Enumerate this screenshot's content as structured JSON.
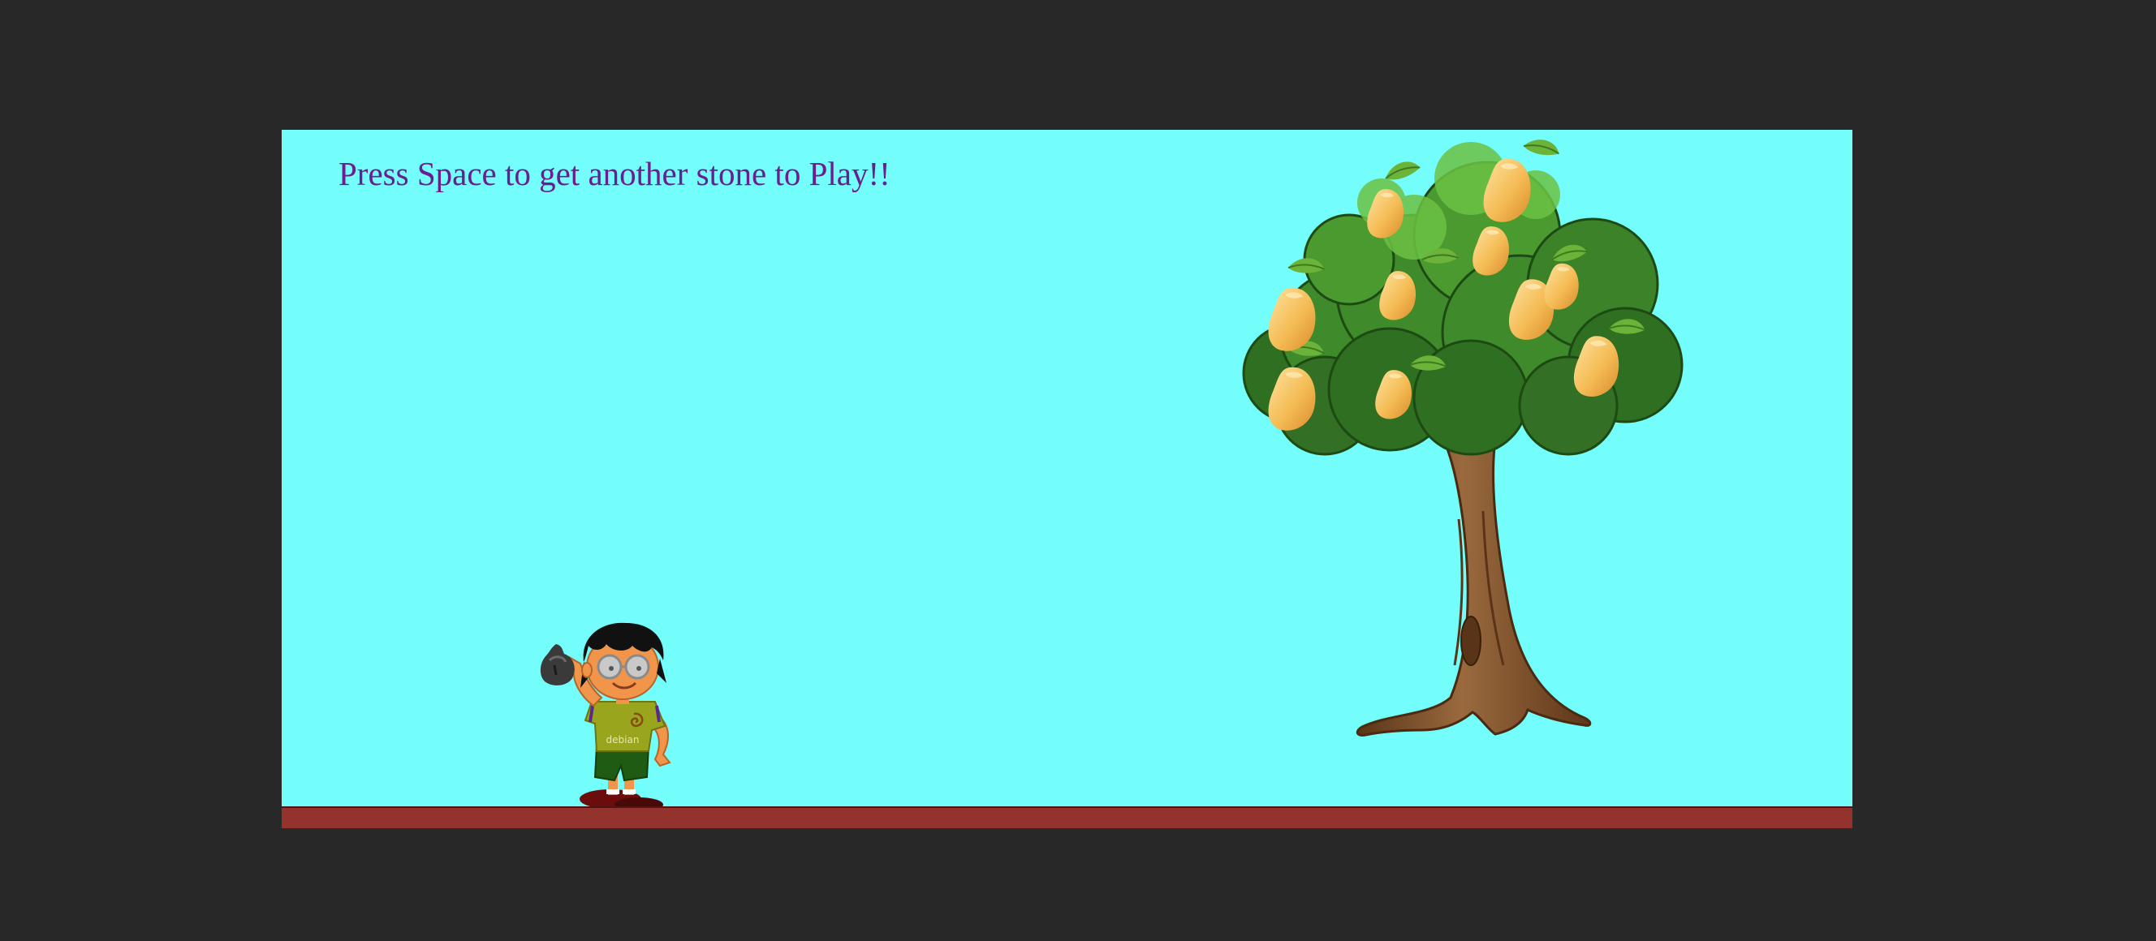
{
  "game": {
    "instruction": "Press Space to get another stone to Play!!",
    "shirt_text": "debian"
  },
  "colors": {
    "page_background": "#282828",
    "sky": "#73fdfb",
    "ground": "#94322e",
    "instruction_text": "#6a1e8f",
    "mango": "#f2b64e",
    "leaves": "#3f8a2a",
    "trunk": "#7a4a26"
  },
  "sprites": {
    "player": "boy-character",
    "projectile": "stone",
    "target": "mango-tree",
    "fruit": "mango"
  }
}
